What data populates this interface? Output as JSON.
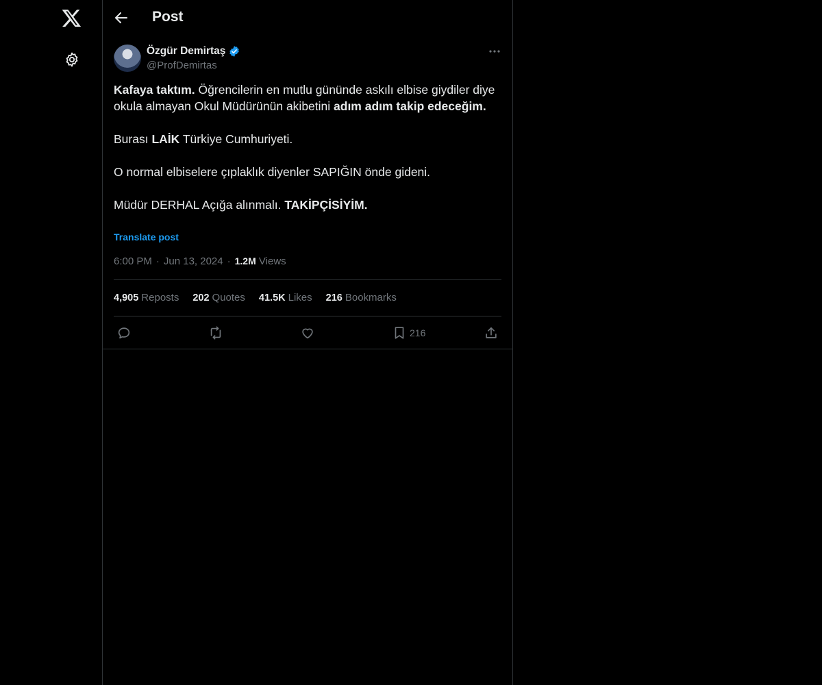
{
  "rail": {
    "icons": [
      "x-logo-icon",
      "gear-icon"
    ]
  },
  "header": {
    "title": "Post"
  },
  "author": {
    "name": "Özgür Demirtaş",
    "handle": "@ProfDemirtas",
    "verified": true
  },
  "post": {
    "p1_bold1": "Kafaya taktım.",
    "p1_text": " Öğrencilerin en mutlu gününde askılı elbise giydiler diye okula almayan Okul Müdürünün akibetini ",
    "p1_bold2": "adım adım takip edeceğim.",
    "p2_text1": "Burası ",
    "p2_bold": "LAİK",
    "p2_text2": " Türkiye Cumhuriyeti.",
    "p3_text": "O normal elbiselere çıplaklık diyenler SAPIĞIN önde gideni.",
    "p4_text": "Müdür DERHAL Açığa alınmalı. ",
    "p4_bold": "TAKİPÇİSİYİM.",
    "translate_label": "Translate post"
  },
  "meta": {
    "time": "6:00 PM",
    "sep1": "·",
    "date": "Jun 13, 2024",
    "sep2": "·",
    "views_count": "1.2M",
    "views_label": "Views"
  },
  "stats": {
    "reposts_count": "4,905",
    "reposts_label": "Reposts",
    "quotes_count": "202",
    "quotes_label": "Quotes",
    "likes_count": "41.5K",
    "likes_label": "Likes",
    "bookmarks_count": "216",
    "bookmarks_label": "Bookmarks"
  },
  "actions": {
    "bookmark_count": "216"
  },
  "colors": {
    "background": "#000000",
    "text": "#e7e9ea",
    "muted": "#71767b",
    "border": "#2f3336",
    "accent": "#1d9bf0"
  }
}
